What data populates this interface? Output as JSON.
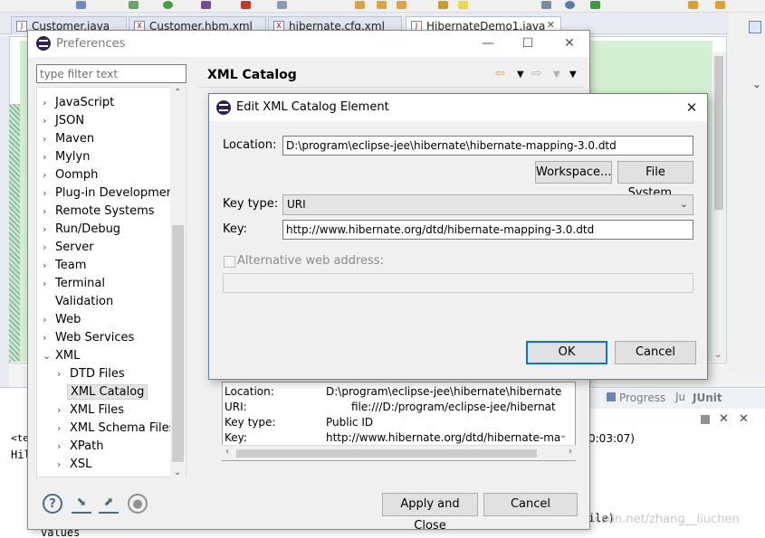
{
  "ide": {
    "editor_tabs": [
      {
        "label": "Customer.java"
      },
      {
        "label": "Customer.hbm.xml"
      },
      {
        "label": "hibernate.cfg.xml"
      },
      {
        "label": "HibernateDemo1.java"
      }
    ],
    "lower_tabs": {
      "progress": "Progress",
      "junit": "JUnit"
    },
    "console_lines": [
      "<te",
      "Hil",
      "0:03:07)",
      "ile)",
      "values"
    ],
    "watermark": "https://blog.csdn.net/zhang__liuchen"
  },
  "preferences": {
    "title": "Preferences",
    "filter_placeholder": "type filter text",
    "tree": [
      {
        "label": "JavaScript",
        "expander": "›"
      },
      {
        "label": "JSON",
        "expander": "›"
      },
      {
        "label": "Maven",
        "expander": "›"
      },
      {
        "label": "Mylyn",
        "expander": "›"
      },
      {
        "label": "Oomph",
        "expander": "›"
      },
      {
        "label": "Plug-in Development",
        "expander": "›"
      },
      {
        "label": "Remote Systems",
        "expander": "›"
      },
      {
        "label": "Run/Debug",
        "expander": "›"
      },
      {
        "label": "Server",
        "expander": "›"
      },
      {
        "label": "Team",
        "expander": "›"
      },
      {
        "label": "Terminal",
        "expander": "›"
      },
      {
        "label": "Validation",
        "expander": ""
      },
      {
        "label": "Web",
        "expander": "›"
      },
      {
        "label": "Web Services",
        "expander": "›"
      },
      {
        "label": "XML",
        "expander": "⌄"
      },
      {
        "label": "DTD Files",
        "expander": "›"
      },
      {
        "label": "XML Catalog",
        "expander": ""
      },
      {
        "label": "XML Files",
        "expander": "›"
      },
      {
        "label": "XML Schema Files",
        "expander": "›"
      },
      {
        "label": "XPath",
        "expander": "›"
      },
      {
        "label": "XSL",
        "expander": "›"
      }
    ],
    "page_title": "XML Catalog",
    "entry_details": {
      "location_label": "Location:",
      "location_value": "D:\\program\\eclipse-jee\\hibernate\\hibernate",
      "uri_label": "URI:",
      "uri_value": "file:///D:/program/eclipse-jee/hibernat",
      "key_type_label": "Key type:",
      "key_type_value": "Public ID",
      "key_label": "Key:",
      "key_value": "http://www.hibernate.org/dtd/hibernate-ma"
    },
    "apply_close_label": "Apply and Close",
    "cancel_label": "Cancel"
  },
  "edit_dialog": {
    "title": "Edit XML Catalog Element",
    "location_label": "Location:",
    "location_value": "D:\\program\\eclipse-jee\\hibernate\\hibernate-mapping-3.0.dtd",
    "workspace_label": "Workspace...",
    "filesystem_label": "File System...",
    "key_type_label": "Key type:",
    "key_type_value": "URI",
    "key_label": "Key:",
    "key_value": "http://www.hibernate.org/dtd/hibernate-mapping-3.0.dtd",
    "alt_web_label": "Alternative web address:",
    "ok_label": "OK",
    "cancel_label": "Cancel"
  }
}
